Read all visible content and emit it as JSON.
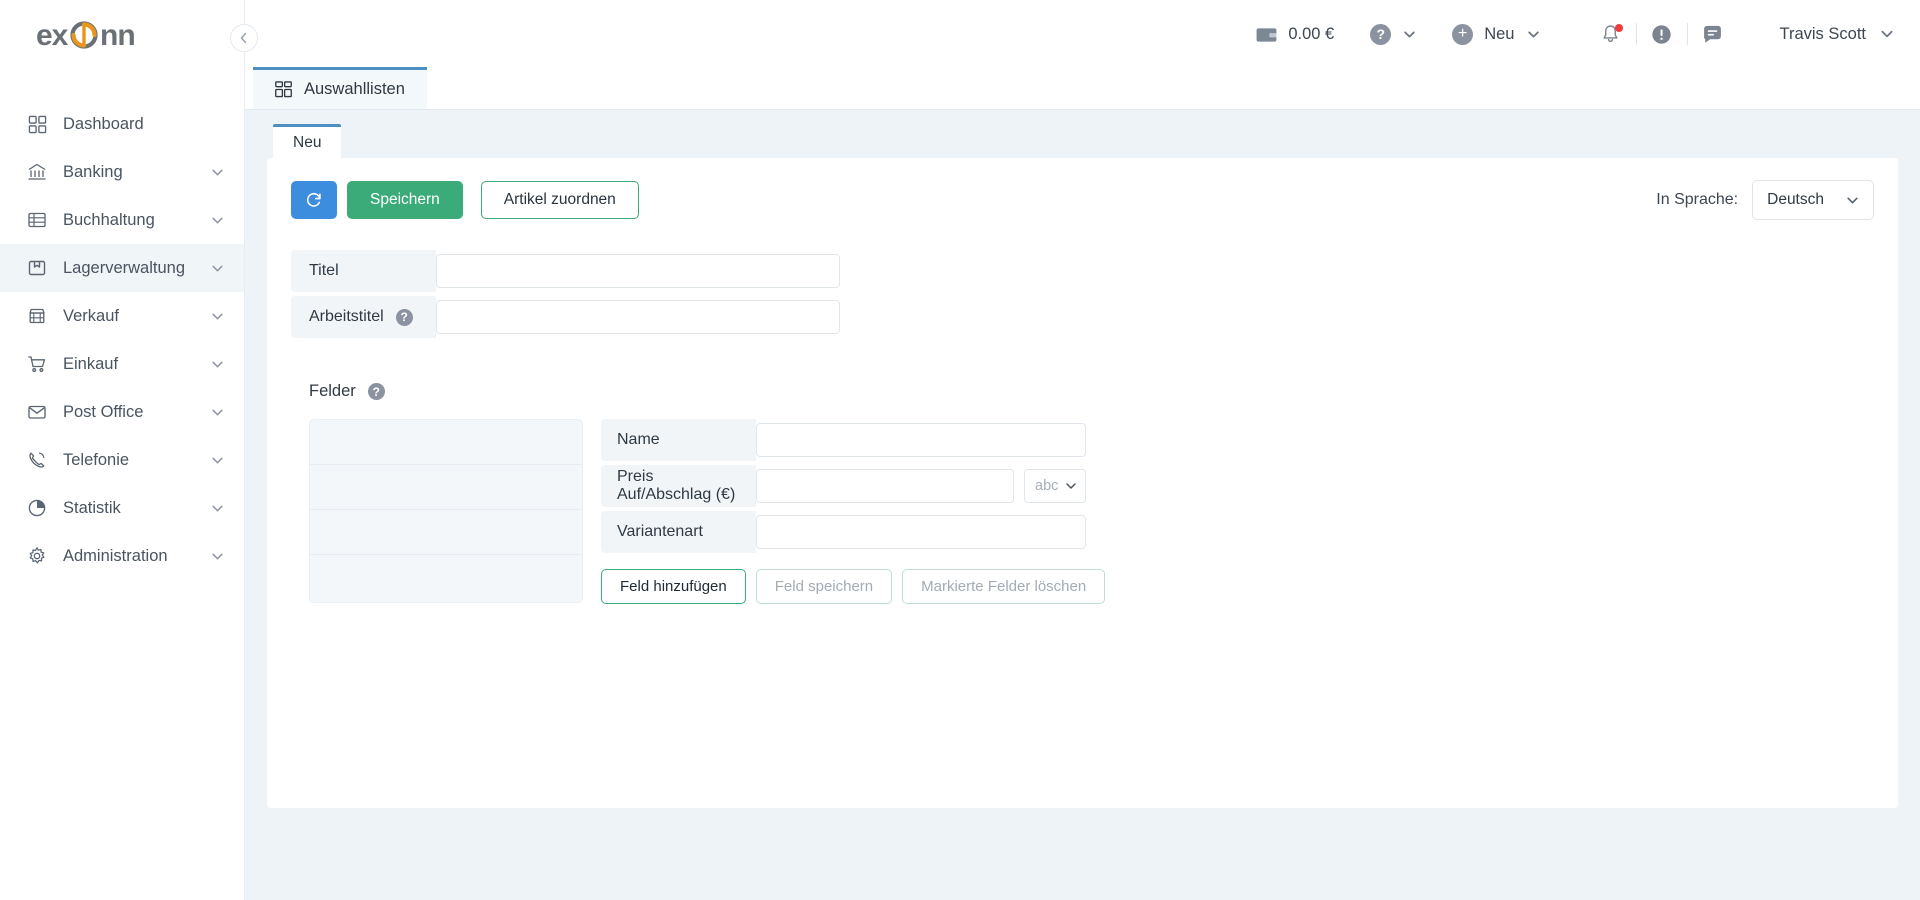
{
  "brand": {
    "name": "exonn",
    "accent": "#e8961e",
    "text_color": "#6b7076"
  },
  "sidebar": {
    "collapse_icon": "chevron-left-icon",
    "items": [
      {
        "label": "Dashboard",
        "icon": "grid-icon",
        "has_chevron": false,
        "active": false
      },
      {
        "label": "Banking",
        "icon": "bank-icon",
        "has_chevron": true,
        "active": false
      },
      {
        "label": "Buchhaltung",
        "icon": "ledger-icon",
        "has_chevron": true,
        "active": false
      },
      {
        "label": "Lagerverwaltung",
        "icon": "package-icon",
        "has_chevron": true,
        "active": true
      },
      {
        "label": "Verkauf",
        "icon": "store-icon",
        "has_chevron": true,
        "active": false
      },
      {
        "label": "Einkauf",
        "icon": "cart-icon",
        "has_chevron": true,
        "active": false
      },
      {
        "label": "Post Office",
        "icon": "envelope-icon",
        "has_chevron": true,
        "active": false
      },
      {
        "label": "Telefonie",
        "icon": "phone-icon",
        "has_chevron": true,
        "active": false
      },
      {
        "label": "Statistik",
        "icon": "pie-chart-icon",
        "has_chevron": true,
        "active": false
      },
      {
        "label": "Administration",
        "icon": "gear-icon",
        "has_chevron": true,
        "active": false
      }
    ]
  },
  "topbar": {
    "wallet_amount": "0.00 €",
    "wallet_icon": "wallet-icon",
    "help_icon": "question-circle-icon",
    "new_label": "Neu",
    "new_icon": "plus-circle-icon",
    "notification_icon": "bell-icon",
    "notification_has_dot": true,
    "alert_icon": "exclamation-circle-icon",
    "chat_icon": "chat-icon",
    "user_name": "Travis Scott",
    "user_chevron_icon": "chevron-down-icon"
  },
  "tabs": [
    {
      "label": "Auswahllisten",
      "icon": "lists-icon",
      "active": true
    }
  ],
  "subtabs": [
    {
      "label": "Neu",
      "active": true
    }
  ],
  "toolbar": {
    "refresh_icon": "refresh-icon",
    "save_label": "Speichern",
    "assign_label": "Artikel zuordnen",
    "language_label": "In Sprache:",
    "language_value": "Deutsch",
    "language_options": [
      "Deutsch"
    ]
  },
  "form": {
    "rows": [
      {
        "label": "Titel",
        "value": "",
        "placeholder": "",
        "help": false
      },
      {
        "label": "Arbeitstitel",
        "value": "",
        "placeholder": "",
        "help": true,
        "help_glyph": "?"
      }
    ]
  },
  "felder": {
    "title": "Felder",
    "help_glyph": "?",
    "list_rows": [
      "",
      "",
      "",
      ""
    ],
    "fields": [
      {
        "label": "Name",
        "value": "",
        "has_select": false
      },
      {
        "label": "Preis Auf/Abschlag (€)",
        "value": "",
        "has_select": true,
        "select_value": "abc",
        "select_options": [
          "abc"
        ]
      },
      {
        "label": "Variantenart",
        "value": "",
        "has_select": false
      }
    ],
    "actions": [
      {
        "label": "Feld hinzufügen",
        "enabled": true
      },
      {
        "label": "Feld speichern",
        "enabled": false
      },
      {
        "label": "Markierte Felder löschen",
        "enabled": false
      }
    ]
  },
  "colors": {
    "primary_blue": "#3c8dde",
    "success_green": "#3aab79",
    "tab_accent": "#4e8fc4",
    "page_bg": "#eef3f7",
    "label_bg": "#f1f5f8",
    "notification_dot": "#ef3b3b"
  }
}
